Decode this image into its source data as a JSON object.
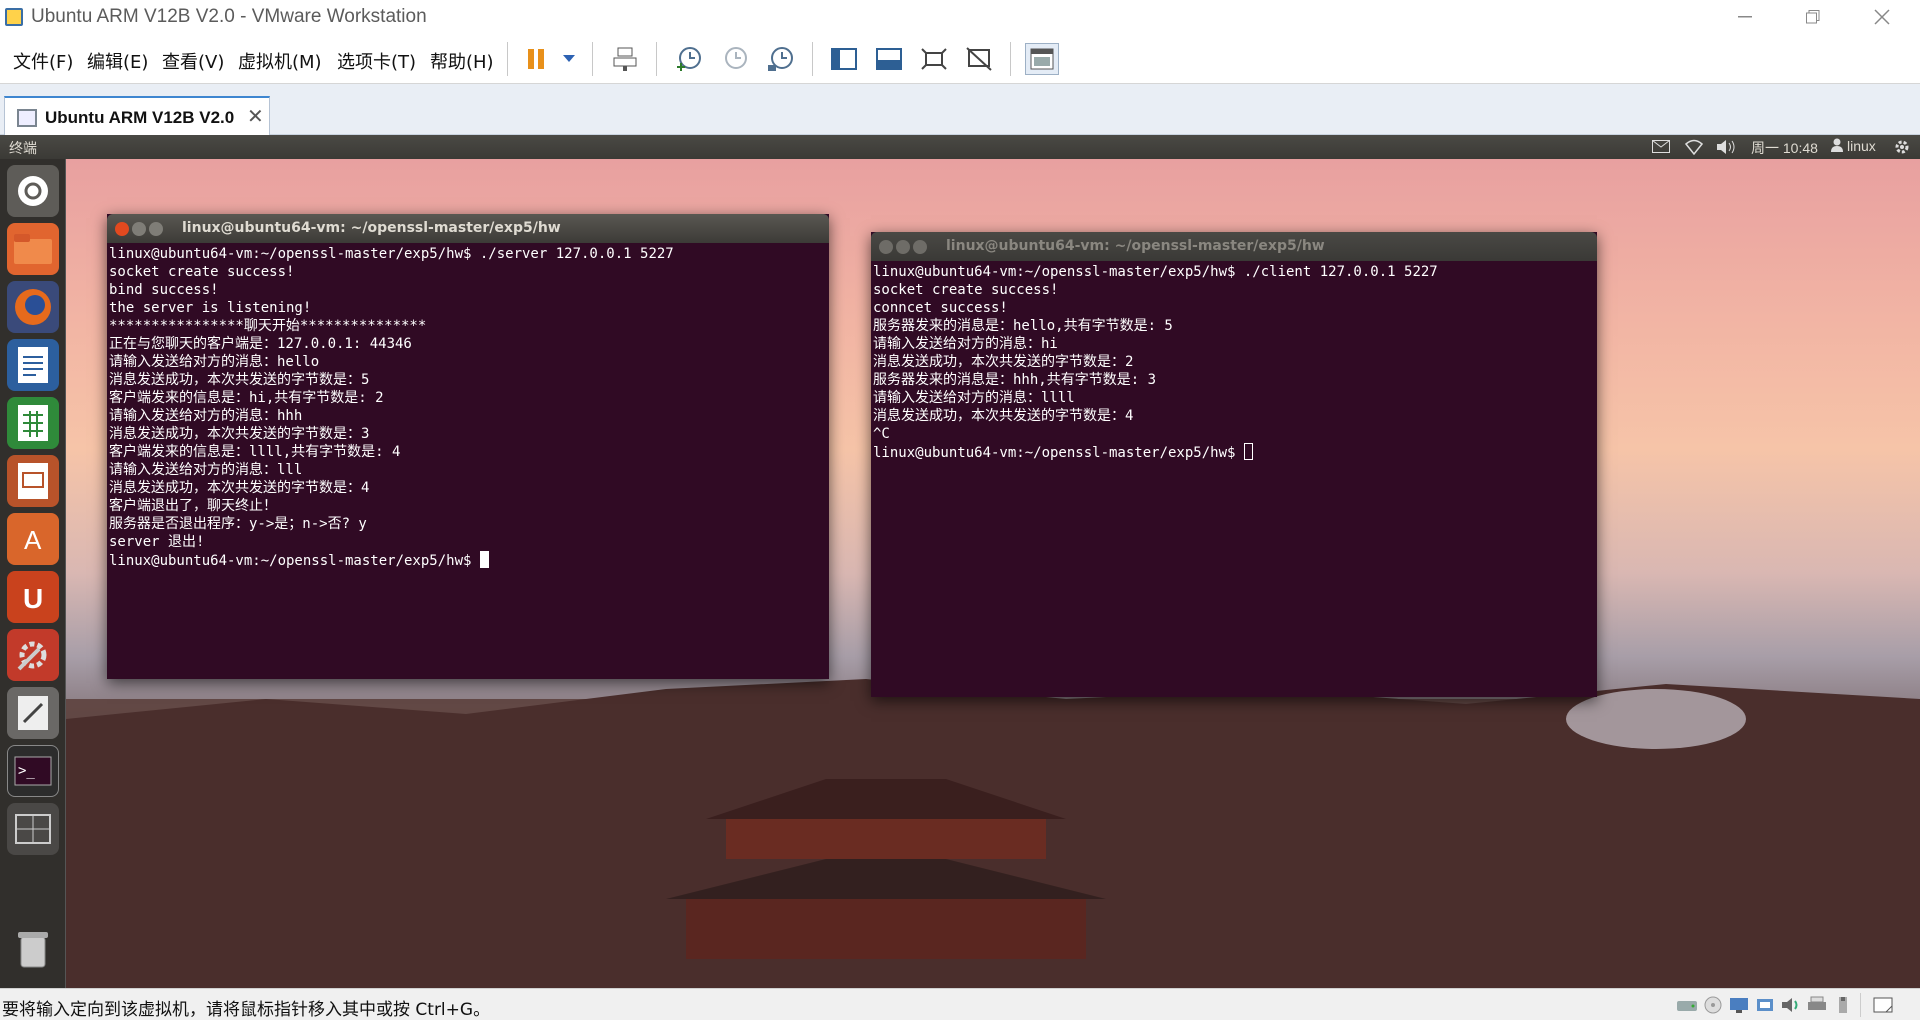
{
  "window": {
    "title": "Ubuntu ARM V12B V2.0 - VMware Workstation"
  },
  "menu": [
    "文件(F)",
    "编辑(E)",
    "查看(V)",
    "虚拟机(M)",
    "选项卡(T)",
    "帮助(H)"
  ],
  "toolbar_icons": [
    "pause-icon",
    "dropdown-arrow-icon",
    "send-ctrl-alt-del-icon",
    "snapshot-icon",
    "revert-snapshot-icon",
    "snapshot-manager-icon",
    "library-view-icon",
    "console-view-icon",
    "fullscreen-icon",
    "unity-icon",
    "thumbnail-view-icon"
  ],
  "tab": {
    "label": "Ubuntu ARM V12B V2.0"
  },
  "ubuntu_panel": {
    "app_title": "终端",
    "clock": "周一 10:48",
    "user": "linux"
  },
  "launcher_icons": [
    "ubuntu-dash-icon",
    "files-icon",
    "firefox-icon",
    "writer-icon",
    "calc-icon",
    "impress-icon",
    "software-center-icon",
    "ubuntu-one-icon",
    "system-settings-icon",
    "text-editor-icon",
    "terminal-icon",
    "workspace-switcher-icon",
    "trash-icon"
  ],
  "terminal_left": {
    "title": "linux@ubuntu64-vm: ~/openssl-master/exp5/hw",
    "lines": [
      "linux@ubuntu64-vm:~/openssl-master/exp5/hw$ ./server 127.0.0.1 5227",
      "socket create success!",
      "bind success!",
      "the server is listening!",
      "****************聊天开始***************",
      "正在与您聊天的客户端是：127.0.0.1: 44346",
      "请输入发送给对方的消息：hello",
      "消息发送成功，本次共发送的字节数是：5",
      "客户端发来的信息是：hi,共有字节数是: 2",
      "请输入发送给对方的消息：hhh",
      "消息发送成功，本次共发送的字节数是：3",
      "客户端发来的信息是：llll,共有字节数是: 4",
      "请输入发送给对方的消息：lll",
      "消息发送成功，本次共发送的字节数是：4",
      "客户端退出了，聊天终止！",
      "服务器是否退出程序：y->是；n->否? y",
      "server 退出!"
    ],
    "prompt": "linux@ubuntu64-vm:~/openssl-master/exp5/hw$ "
  },
  "terminal_right": {
    "title": "linux@ubuntu64-vm: ~/openssl-master/exp5/hw",
    "lines": [
      "linux@ubuntu64-vm:~/openssl-master/exp5/hw$ ./client 127.0.0.1 5227",
      "socket create success!",
      "conncet success!",
      "服务器发来的消息是：hello,共有字节数是: 5",
      "请输入发送给对方的消息：hi",
      "消息发送成功，本次共发送的字节数是：2",
      "服务器发来的消息是：hhh,共有字节数是: 3",
      "请输入发送给对方的消息：llll",
      "消息发送成功，本次共发送的字节数是：4",
      "^C"
    ],
    "prompt": "linux@ubuntu64-vm:~/openssl-master/exp5/hw$ "
  },
  "statusbar": {
    "message": "要将输入定向到该虚拟机，请将鼠标指针移入其中或按 Ctrl+G。"
  },
  "colors": {
    "terminal_bg": "#300a24",
    "accent": "#3e86d0",
    "ubuntu_close": "#e2491f"
  }
}
